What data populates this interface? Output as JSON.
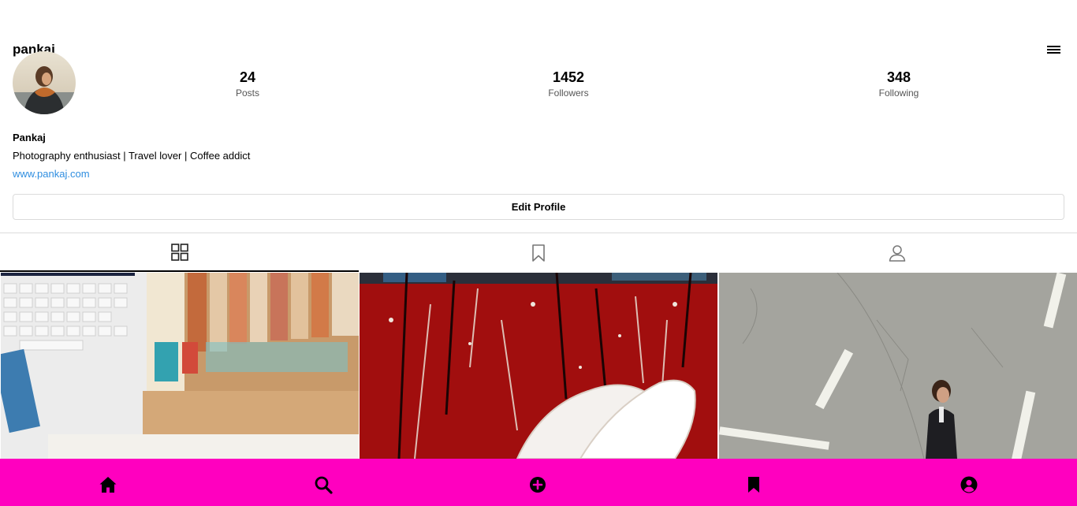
{
  "header": {
    "username": "pankaj",
    "menu_icon": "hamburger-menu-icon"
  },
  "profile": {
    "avatar_alt": "profile photo",
    "stats": [
      {
        "value": "24",
        "label": "Posts"
      },
      {
        "value": "1452",
        "label": "Followers"
      },
      {
        "value": "348",
        "label": "Following"
      }
    ],
    "display_name": "Pankaj",
    "bio": "Photography enthusiast | Travel lover | Coffee addict",
    "website": "www.pankaj.com",
    "edit_button": "Edit Profile"
  },
  "tabs": [
    {
      "icon": "grid-icon",
      "active": true
    },
    {
      "icon": "bookmark-icon",
      "active": false
    },
    {
      "icon": "tagged-user-icon",
      "active": false
    }
  ],
  "posts": [
    {
      "subject": "laptop and books"
    },
    {
      "subject": "white shoes on red painted wood"
    },
    {
      "subject": "man walking on asphalt road"
    }
  ],
  "bottom_nav": {
    "background": "#ff00bf",
    "items": [
      "home-icon",
      "search-icon",
      "add-post-icon",
      "bookmark-icon",
      "profile-icon"
    ]
  }
}
